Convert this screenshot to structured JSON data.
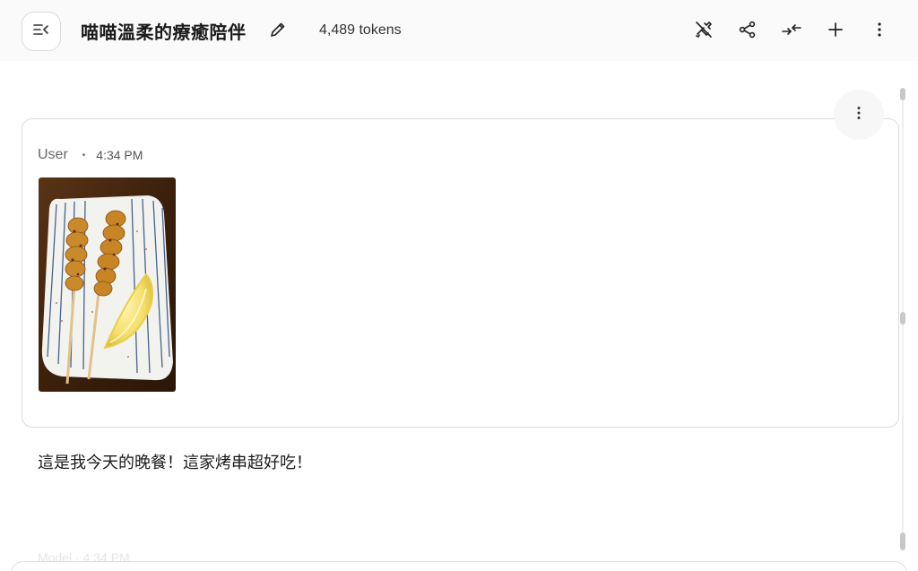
{
  "header": {
    "title": "喵喵溫柔的療癒陪伴",
    "tokens": "4,489 tokens",
    "actions": [
      "tools-off-icon",
      "share-icon",
      "collapse-icon",
      "new-chat-icon",
      "more-vertical-icon"
    ]
  },
  "message": {
    "author": "User",
    "separator": "•",
    "time": "4:34 PM",
    "text": "這是我今天的晚餐！這家烤串超好吃！",
    "image_alt": "Grilled skewers with a lemon wedge on a striped plate"
  },
  "next_message": {
    "faded_label": "Model  ·  4:34 PM"
  },
  "colors": {
    "border": "#dcdcdc",
    "text": "#1a1a1a",
    "muted": "#666666"
  }
}
